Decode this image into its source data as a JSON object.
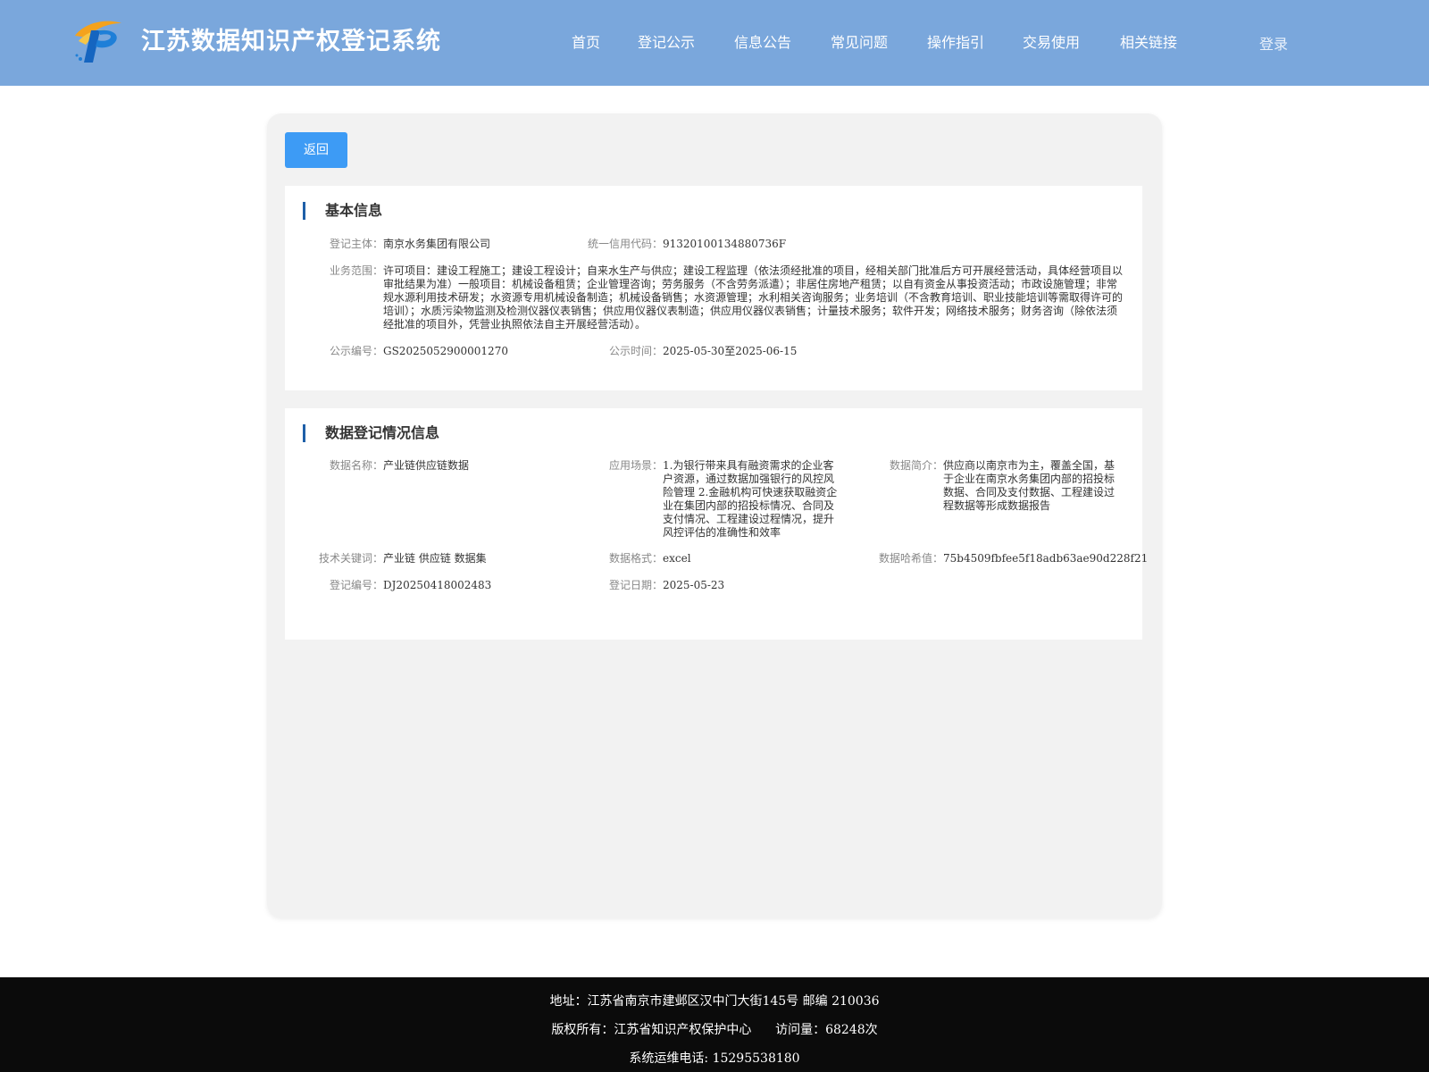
{
  "header": {
    "site_title": "江苏数据知识产权登记系统",
    "logo_icon": "jiangsu-ip-logo",
    "colors": {
      "header_bg": "#7aa7dc",
      "accent": "#3d9bf5",
      "section_marker": "#1e5fa8"
    },
    "nav": [
      {
        "label": "首页"
      },
      {
        "label": "登记公示"
      },
      {
        "label": "信息公告"
      },
      {
        "label": "常见问题"
      },
      {
        "label": "操作指引"
      },
      {
        "label": "交易使用"
      },
      {
        "label": "相关链接"
      }
    ],
    "login_label": "登录"
  },
  "panel": {
    "back_label": "返回",
    "basic": {
      "title": "基本信息",
      "subject_label": "登记主体：",
      "subject_value": "南京水务集团有限公司",
      "credit_label": "统一信用代码：",
      "credit_value": "91320100134880736F",
      "scope_label": "业务范围：",
      "scope_value": "许可项目：建设工程施工；建设工程设计；自来水生产与供应；建设工程监理（依法须经批准的项目，经相关部门批准后方可开展经营活动，具体经营项目以审批结果为准）一般项目：机械设备租赁；企业管理咨询；劳务服务（不含劳务派遣）；非居住房地产租赁；以自有资金从事投资活动；市政设施管理；非常规水源利用技术研发；水资源专用机械设备制造；机械设备销售；水资源管理；水利相关咨询服务；业务培训（不含教育培训、职业技能培训等需取得许可的培训）；水质污染物监测及检测仪器仪表销售；供应用仪器仪表制造；供应用仪器仪表销售；计量技术服务；软件开发；网络技术服务；财务咨询（除依法须经批准的项目外，凭营业执照依法自主开展经营活动）。",
      "notice_no_label": "公示编号：",
      "notice_no_value": "GS2025052900001270",
      "notice_time_label": "公示时间：",
      "notice_time_value": "2025-05-30至2025-06-15"
    },
    "data_reg": {
      "title": "数据登记情况信息",
      "name_label": "数据名称：",
      "name_value": "产业链供应链数据",
      "scenario_label": "应用场景：",
      "scenario_value": "1.为银行带来具有融资需求的企业客户资源，通过数据加强银行的风控风险管理 2.金融机构可快速获取融资企业在集团内部的招投标情况、合同及支付情况、工程建设过程情况，提升风控评估的准确性和效率",
      "intro_label": "数据简介：",
      "intro_value": "供应商以南京市为主，覆盖全国，基于企业在南京水务集团内部的招投标数据、合同及支付数据、工程建设过程数据等形成数据报告",
      "keywords_label": "技术关键词：",
      "keywords_value": "产业链 供应链 数据集",
      "format_label": "数据格式：",
      "format_value": "excel",
      "hash_label": "数据哈希值：",
      "hash_value": "75b4509fbfee5f18adb63ae90d228f21",
      "reg_no_label": "登记编号：",
      "reg_no_value": "DJ20250418002483",
      "reg_date_label": "登记日期：",
      "reg_date_value": "2025-05-23"
    }
  },
  "footer": {
    "address": "地址：江苏省南京市建邺区汉中门大街145号 邮编 210036",
    "copyright": "版权所有：江苏省知识产权保护中心      访问量：68248次",
    "hotline": "系统运维电话: 15295538180"
  }
}
